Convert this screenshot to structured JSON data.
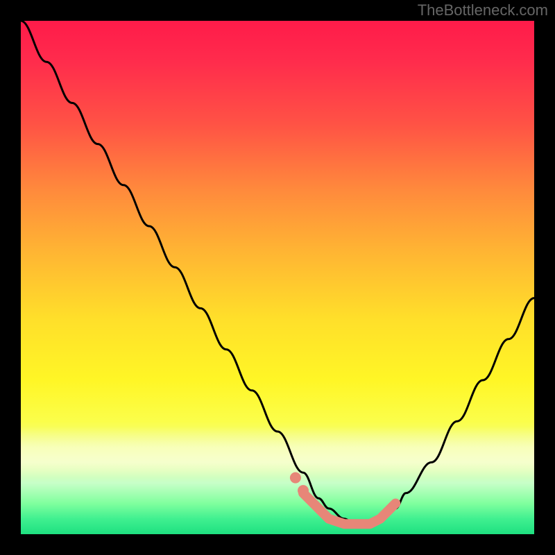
{
  "attribution": "TheBottleneck.com",
  "colors": {
    "page_bg": "#000000",
    "curve_stroke": "#000000",
    "highlight": "#e78678"
  },
  "chart_data": {
    "type": "line",
    "title": "",
    "xlabel": "",
    "ylabel": "",
    "xlim": [
      0,
      100
    ],
    "ylim": [
      0,
      100
    ],
    "grid": false,
    "series": [
      {
        "name": "bottleneck-curve",
        "x": [
          0,
          5,
          10,
          15,
          20,
          25,
          30,
          35,
          40,
          45,
          50,
          55,
          58,
          60,
          63,
          65,
          68,
          70,
          73,
          75,
          80,
          85,
          90,
          95,
          100
        ],
        "values": [
          100,
          92,
          84,
          76,
          68,
          60,
          52,
          44,
          36,
          28,
          20,
          12,
          7,
          5,
          3,
          2,
          2,
          3,
          5,
          8,
          14,
          22,
          30,
          38,
          46
        ]
      }
    ],
    "annotations": [
      {
        "name": "bottom-highlight-segment",
        "shape": "polyline",
        "x": [
          55,
          58,
          60,
          63,
          65,
          68,
          70,
          73
        ],
        "y": [
          8,
          5,
          3,
          2,
          2,
          2,
          3,
          6
        ]
      },
      {
        "name": "highlight-dot-1",
        "shape": "dot",
        "x": 53.5,
        "y": 11
      },
      {
        "name": "highlight-dot-2",
        "shape": "dot",
        "x": 55.0,
        "y": 8.5
      }
    ]
  }
}
